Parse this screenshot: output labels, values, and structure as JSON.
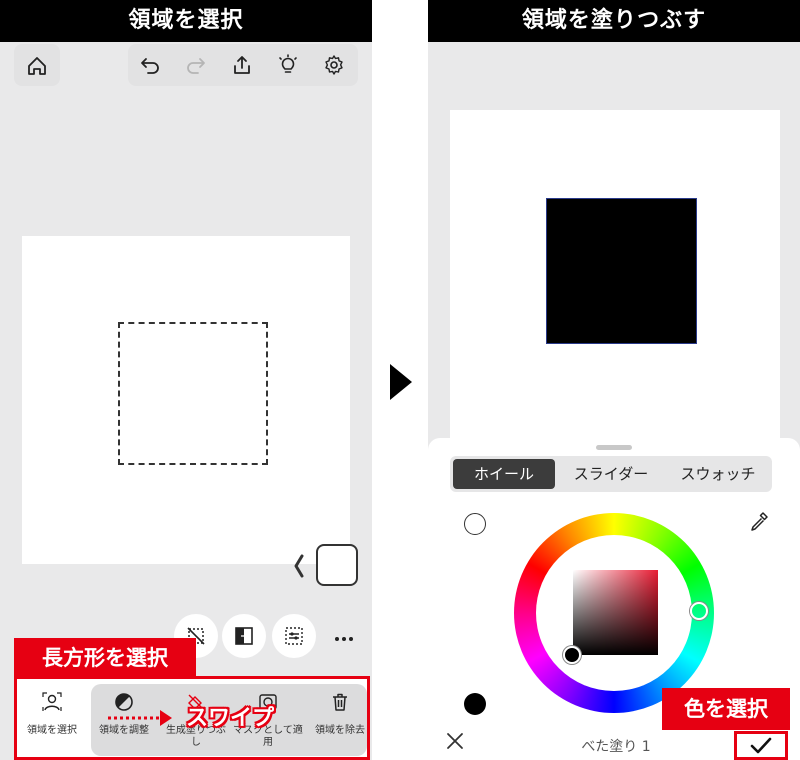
{
  "left_panel": {
    "title": "領域を選択",
    "shape_label": "長方形を選択",
    "swipe_label": "スワイプ",
    "tools": [
      {
        "label": "領域を選択"
      },
      {
        "label": "領域を調整"
      },
      {
        "label": "生成塗りつぶし"
      },
      {
        "label": "マスクとして適用"
      },
      {
        "label": "領域を除去"
      }
    ]
  },
  "right_panel": {
    "title": "領域を塗りつぶす",
    "tabs": [
      {
        "label": "ホイール",
        "active": true
      },
      {
        "label": "スライダー",
        "active": false
      },
      {
        "label": "スウォッチ",
        "active": false
      }
    ],
    "fill_name": "べた塗り 1",
    "color_label": "色を選択",
    "selected_color": "#000000",
    "hue_color": "#e81d34"
  },
  "colors": {
    "accent_red": "#e60012",
    "panel_bg": "#e9e9ea"
  }
}
